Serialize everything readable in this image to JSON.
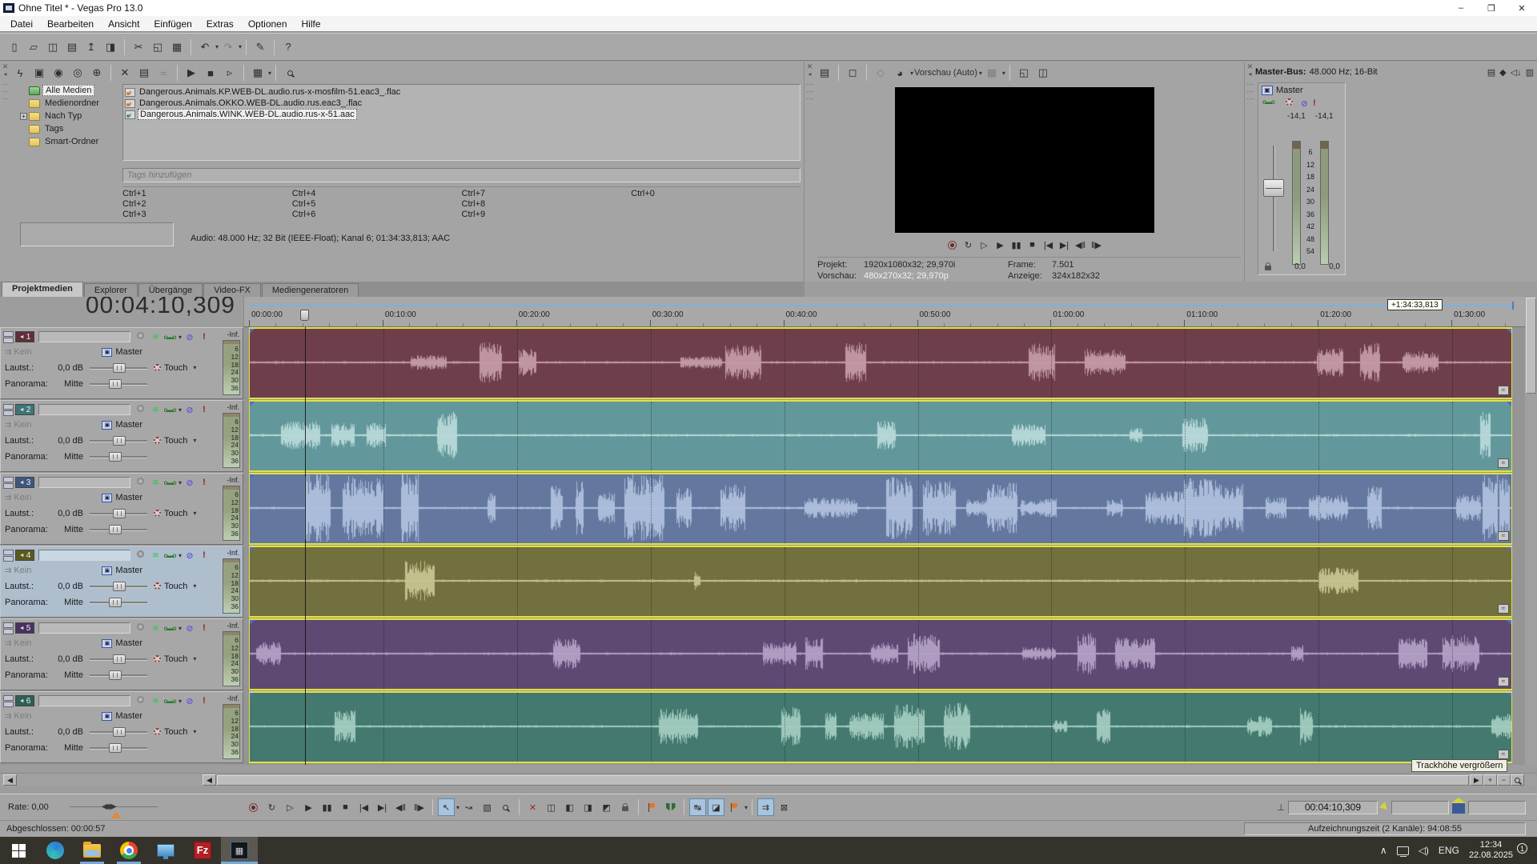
{
  "window": {
    "title": "Ohne Titel * - Vegas Pro 13.0",
    "minimize": "–",
    "maximize": "❐",
    "close": "✕"
  },
  "menu": {
    "items": [
      "Datei",
      "Bearbeiten",
      "Ansicht",
      "Einfügen",
      "Extras",
      "Optionen",
      "Hilfe"
    ]
  },
  "main_toolbar": [
    {
      "name": "new-project-button",
      "glyph": "▯"
    },
    {
      "name": "open-button",
      "glyph": "▱"
    },
    {
      "name": "save-button",
      "glyph": "◫"
    },
    {
      "name": "project-properties-button",
      "glyph": "▤"
    },
    {
      "name": "publish-button",
      "glyph": "↥"
    },
    {
      "name": "render-as-button",
      "glyph": "◨"
    },
    {
      "sep": true
    },
    {
      "name": "cut-button",
      "glyph": "✂"
    },
    {
      "name": "copy-button",
      "glyph": "◱"
    },
    {
      "name": "paste-button",
      "glyph": "▦"
    },
    {
      "sep": true
    },
    {
      "name": "undo-button",
      "glyph": "↶",
      "dd": true
    },
    {
      "name": "redo-button",
      "glyph": "↷",
      "dd": true,
      "disabled": true
    },
    {
      "sep": true
    },
    {
      "name": "event-paint-button",
      "glyph": "✎"
    },
    {
      "sep": true
    },
    {
      "name": "context-help-button",
      "glyph": "?"
    }
  ],
  "media_panel": {
    "toolbar": [
      {
        "name": "auto-preview-toggle",
        "glyph": "ϟ"
      },
      {
        "name": "import-media-button",
        "glyph": "▣"
      },
      {
        "name": "capture-video-button",
        "glyph": "◉"
      },
      {
        "name": "extract-audio-button",
        "glyph": "◎"
      },
      {
        "name": "get-media-web-button",
        "glyph": "⊕"
      },
      {
        "sep": true
      },
      {
        "name": "remove-media-button",
        "glyph": "✕",
        "red": true
      },
      {
        "name": "media-properties-button",
        "glyph": "▤"
      },
      {
        "name": "media-fx-button",
        "glyph": "≈",
        "disabled": true
      },
      {
        "sep": true
      },
      {
        "name": "preview-play-button",
        "glyph": "▶"
      },
      {
        "name": "preview-stop-button",
        "glyph": "■"
      },
      {
        "name": "preview-auto-button",
        "glyph": "▹"
      },
      {
        "sep": true
      },
      {
        "name": "view-mode-button",
        "glyph": "▦",
        "dd": true
      },
      {
        "sep": true
      },
      {
        "name": "search-media-button",
        "glyph": "search"
      }
    ],
    "tree": [
      {
        "label": "Alle Medien",
        "selected": true,
        "icon": "media-all"
      },
      {
        "label": "Medienordner"
      },
      {
        "label": "Nach Typ",
        "expander": "+"
      },
      {
        "label": "Tags"
      },
      {
        "label": "Smart-Ordner"
      }
    ],
    "files": [
      {
        "name": "Dangerous.Animals.KP.WEB-DL.audio.rus-x-mosfilm-51.eac3_.flac",
        "icon": "orange",
        "glyph": "♪"
      },
      {
        "name": "Dangerous.Animals.OKKO.WEB-DL.audio.rus.eac3_.flac",
        "icon": "orange",
        "glyph": "♪"
      },
      {
        "name": "Dangerous.Animals.WINK.WEB-DL.audio.rus-x-51.aac",
        "icon": "blue",
        "glyph": "♪",
        "selected": true
      }
    ],
    "tags_placeholder": "Tags hinzufügen",
    "shortcuts": [
      "Ctrl+1",
      "Ctrl+2",
      "Ctrl+3",
      "Ctrl+4",
      "Ctrl+5",
      "Ctrl+6",
      "Ctrl+7",
      "Ctrl+8",
      "Ctrl+9",
      "Ctrl+0",
      "",
      ""
    ],
    "info": "Audio: 48.000 Hz; 32 Bit (IEEE-Float); Kanal 6; 01:34:33,813; AAC"
  },
  "tabs": [
    {
      "label": "Projektmedien",
      "active": true
    },
    {
      "label": "Explorer"
    },
    {
      "label": "Übergänge"
    },
    {
      "label": "Video-FX"
    },
    {
      "label": "Mediengeneratoren"
    }
  ],
  "preview": {
    "toolbar": [
      {
        "name": "preview-properties-button",
        "glyph": "▤"
      },
      {
        "sep": true
      },
      {
        "name": "external-monitor-button",
        "glyph": "◻"
      },
      {
        "sep": true
      },
      {
        "name": "event-overlay-button",
        "glyph": "◇",
        "disabled": true
      },
      {
        "name": "quality-button",
        "glyph": "◕",
        "dd": true
      },
      {
        "name": "quality-label",
        "label": "Vorschau (Auto)",
        "dd": true
      },
      {
        "name": "grid-overlay-button",
        "glyph": "▦",
        "dd": true,
        "disabled": true
      },
      {
        "sep": true
      },
      {
        "name": "copy-frame-button",
        "glyph": "◱"
      },
      {
        "name": "save-frame-button",
        "glyph": "◫"
      }
    ],
    "transport": [
      {
        "name": "preview-record-button",
        "glyph": "rec"
      },
      {
        "name": "preview-loop-button",
        "glyph": "↻"
      },
      {
        "name": "preview-play-start-button",
        "glyph": "▷"
      },
      {
        "name": "preview-play-button",
        "glyph": "▶"
      },
      {
        "name": "preview-pause-button",
        "glyph": "▮▮"
      },
      {
        "name": "preview-stop-button",
        "glyph": "■"
      },
      {
        "name": "preview-go-start-button",
        "glyph": "|◀"
      },
      {
        "name": "preview-go-end-button",
        "glyph": "▶|"
      },
      {
        "name": "preview-prev-frame-button",
        "glyph": "◀‖"
      },
      {
        "name": "preview-next-frame-button",
        "glyph": "‖▶"
      }
    ],
    "info": {
      "projekt_label": "Projekt:",
      "projekt": "1920x1080x32; 29,970i",
      "frame_label": "Frame:",
      "frame": "7.501",
      "vorschau_label": "Vorschau:",
      "vorschau": "480x270x32; 29,970p",
      "anzeige_label": "Anzeige:",
      "anzeige": "324x182x32"
    }
  },
  "master_bus": {
    "title": "Master-Bus:",
    "subtitle": "48.000 Hz; 16-Bit",
    "icons": [
      {
        "name": "master-properties-button",
        "glyph": "▤"
      },
      {
        "name": "downmix-output-button",
        "glyph": "◆"
      },
      {
        "name": "dim-output-button",
        "glyph": "◁↓"
      },
      {
        "name": "meter-options-button",
        "glyph": "▥"
      }
    ],
    "track_label": "Master",
    "peak_left": "-14,1",
    "peak_right": "-14,1",
    "scale": [
      "6",
      "12",
      "18",
      "24",
      "30",
      "36",
      "42",
      "48",
      "54"
    ],
    "value_left": "0,0",
    "value_right": "0,0"
  },
  "timeline": {
    "timecode": "00:04:10,309",
    "ruler_ticks": [
      "00:00:00",
      "00:10:00",
      "00:20:00",
      "00:30:00",
      "00:40:00",
      "00:50:00",
      "01:00:00",
      "01:10:00",
      "01:20:00",
      "01:30:00"
    ],
    "drag_label": "+1:34:33,813",
    "tooltip": "Trackhöhe vergrößern"
  },
  "track_labels": {
    "input": "Kein",
    "bus": "Master",
    "volume_label": "Lautst.:",
    "volume": "0,0 dB",
    "automation": "Touch",
    "pan_label": "Panorama:",
    "pan": "Mitte",
    "peak": "-Inf.",
    "meter_scale": [
      "6",
      "12",
      "18",
      "24",
      "30",
      "36"
    ]
  },
  "tracks": [
    {
      "number": "1",
      "event_color": "#6e3f4a",
      "wave_color": "#c79fab",
      "swatch_color": "#5e2f3a",
      "selected": false,
      "density": 0.9,
      "amp": 0.5,
      "seed": 11
    },
    {
      "number": "2",
      "event_color": "#62989b",
      "wave_color": "#bcdcdc",
      "swatch_color": "#3f7478",
      "selected": false,
      "density": 0.9,
      "amp": 0.55,
      "seed": 22
    },
    {
      "number": "3",
      "event_color": "#64789f",
      "wave_color": "#b3c3e0",
      "swatch_color": "#3f5680",
      "selected": false,
      "density": 2.8,
      "amp": 0.95,
      "seed": 33
    },
    {
      "number": "4",
      "event_color": "#71703e",
      "wave_color": "#cbc896",
      "swatch_color": "#5a5a1e",
      "selected": true,
      "density": 0.32,
      "amp": 0.7,
      "seed": 44
    },
    {
      "number": "5",
      "event_color": "#5e4973",
      "wave_color": "#b6a4c9",
      "swatch_color": "#48325e",
      "selected": false,
      "density": 0.75,
      "amp": 0.5,
      "seed": 55
    },
    {
      "number": "6",
      "event_color": "#43796f",
      "wave_color": "#a9cfc4",
      "swatch_color": "#2e5f56",
      "selected": false,
      "density": 0.85,
      "amp": 0.55,
      "seed": 66
    }
  ],
  "bottom_transport": [
    [
      {
        "name": "record-button",
        "glyph": "rec"
      },
      {
        "name": "loop-playback-button",
        "glyph": "↻"
      },
      {
        "name": "play-from-start-button",
        "glyph": "▷"
      },
      {
        "name": "play-button",
        "glyph": "▶"
      },
      {
        "name": "pause-button",
        "glyph": "▮▮"
      },
      {
        "name": "stop-button",
        "glyph": "■"
      },
      {
        "name": "go-to-start-button",
        "glyph": "|◀"
      },
      {
        "name": "go-to-end-button",
        "glyph": "▶|"
      },
      {
        "name": "prev-frame-button",
        "glyph": "◀‖"
      },
      {
        "name": "next-frame-button",
        "glyph": "‖▶"
      }
    ],
    [
      {
        "name": "edit-tool-normal",
        "glyph": "↖",
        "active": true,
        "dd": true
      },
      {
        "name": "envelope-tool",
        "glyph": "↝"
      },
      {
        "name": "selection-tool",
        "glyph": "▧"
      },
      {
        "name": "zoom-tool",
        "glyph": "search"
      }
    ],
    [
      {
        "name": "delete-button",
        "glyph": "✕",
        "red": true
      },
      {
        "name": "trim-event-button",
        "glyph": "◫",
        "disabled": true
      },
      {
        "name": "split-trim-left-button",
        "glyph": "◧"
      },
      {
        "name": "split-trim-right-button",
        "glyph": "◨"
      },
      {
        "name": "split-event-button",
        "glyph": "◩"
      },
      {
        "name": "lock-event-button",
        "glyph": "lock"
      }
    ],
    [
      {
        "name": "insert-marker-button",
        "glyph": "flag-o"
      },
      {
        "name": "insert-region-button",
        "glyph": "flag-g"
      }
    ],
    [
      {
        "name": "snapping-toggle",
        "glyph": "↹",
        "active": true
      },
      {
        "name": "quantize-frames-toggle",
        "glyph": "◪",
        "active": true
      },
      {
        "name": "insert-command-marker-button",
        "glyph": "flag-o",
        "dd": true
      }
    ],
    [
      {
        "name": "auto-ripple-toggle",
        "glyph": "⇉",
        "active": true
      },
      {
        "name": "lock-envelopes-toggle",
        "glyph": "⊠"
      }
    ]
  ],
  "rate": {
    "label": "Rate: 0,00"
  },
  "cursor_time": "00:04:10,309",
  "status": {
    "left": "Abgeschlossen: 00:00:57",
    "right": "Aufzeichnungszeit (2 Kanäle): 94:08:55"
  },
  "taskbar": {
    "apps": [
      {
        "name": "taskbar-start-button",
        "icon": "start"
      },
      {
        "name": "taskbar-edge",
        "icon": "edge"
      },
      {
        "name": "taskbar-explorer",
        "icon": "folder",
        "running": true
      },
      {
        "name": "taskbar-chrome",
        "icon": "chrome",
        "running": true
      },
      {
        "name": "taskbar-remote-desktop",
        "icon": "monitor"
      },
      {
        "name": "taskbar-filezilla",
        "icon": "fz"
      },
      {
        "name": "taskbar-vegas",
        "icon": "vegas",
        "active": true
      }
    ],
    "lang": "ENG",
    "time": "12:34",
    "date": "22.08.2025",
    "badge": "1"
  }
}
